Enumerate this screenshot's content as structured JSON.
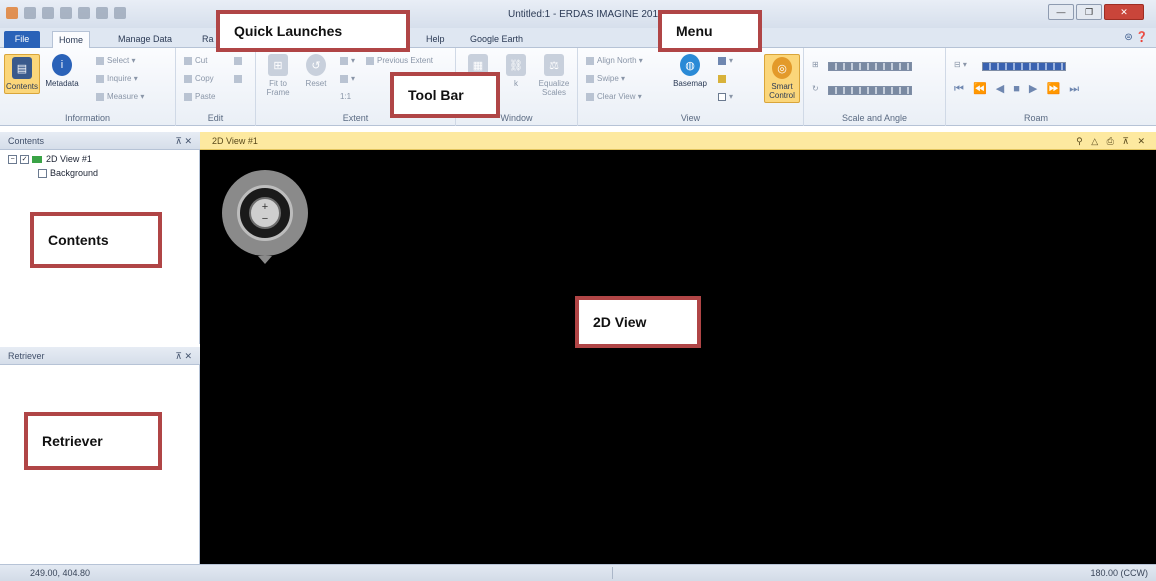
{
  "window": {
    "title": "Untitled:1 - ERDAS IMAGINE 2015",
    "btn_min": "—",
    "btn_max": "❐",
    "btn_close": "✕"
  },
  "tabs": [
    {
      "label": "File"
    },
    {
      "label": "Home"
    },
    {
      "label": "Manage Data"
    },
    {
      "label": "Ra"
    },
    {
      "label": "Help"
    },
    {
      "label": "Google Earth"
    }
  ],
  "ribbon": {
    "information": {
      "label": "Information",
      "contents": "Contents",
      "metadata": "Metadata",
      "select": "Select",
      "inquire": "Inquire",
      "measure": "Measure"
    },
    "edit": {
      "label": "Edit",
      "cut": "Cut",
      "copy": "Copy",
      "paste": "Paste"
    },
    "extent": {
      "label": "Extent",
      "fit_to_frame": "Fit to Frame",
      "reset": "Reset",
      "previous_extent": "Previous Extent",
      "one_to_one": "1:1"
    },
    "window": {
      "label": "Window",
      "link": "k",
      "equalize": "Equalize Scales"
    },
    "view": {
      "label": "View",
      "align_north": "Align North",
      "swipe": "Swipe",
      "clear_view": "Clear View",
      "basemap": "Basemap",
      "smart_control": "Smart Control"
    },
    "scale": {
      "label": "Scale and Angle"
    },
    "roam": {
      "label": "Roam"
    }
  },
  "panels": {
    "contents": {
      "title": "Contents",
      "items": [
        {
          "label": "2D View #1"
        },
        {
          "label": "Background"
        }
      ]
    },
    "retriever": {
      "title": "Retriever"
    },
    "pin_close": "⊼ ✕"
  },
  "view": {
    "tab": "2D View #1",
    "icons": "⚲ △ ⎙ ⊼ ✕",
    "zoom_in": "+",
    "zoom_out": "−"
  },
  "status": {
    "coords": "249.00, 404.80",
    "angle": "180.00 (CCW)"
  },
  "annotations": [
    {
      "label": "Quick Launches"
    },
    {
      "label": "Menu"
    },
    {
      "label": "Tool Bar"
    },
    {
      "label": "Contents"
    },
    {
      "label": "2D View"
    },
    {
      "label": "Retriever"
    }
  ],
  "colors": {
    "callout_border": "#b04546",
    "view_header": "#fde9a0",
    "file_tab": "#2a62b8"
  }
}
